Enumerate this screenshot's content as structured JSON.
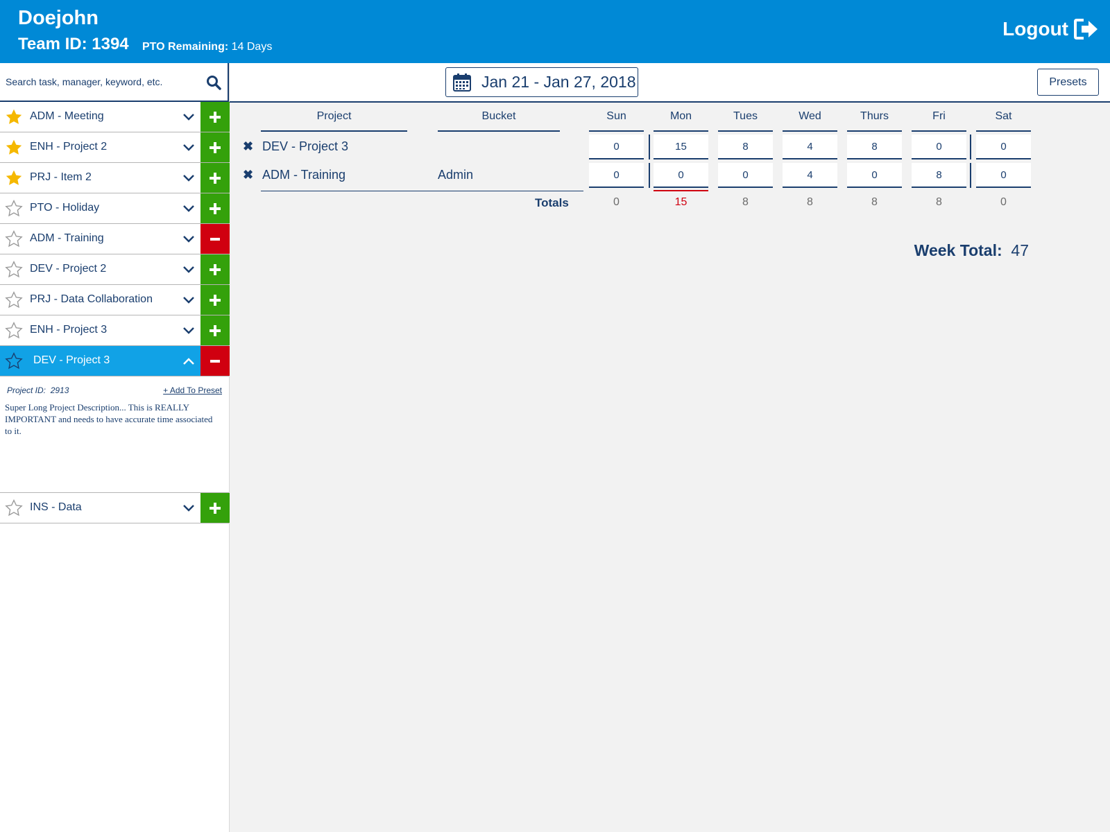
{
  "header": {
    "user_name": "Doejohn",
    "team_id": "Team ID: 1394",
    "pto_label": "PTO Remaining:",
    "pto_value": "14 Days",
    "logout_label": "Logout"
  },
  "search": {
    "placeholder": "Search task, manager, keyword, etc."
  },
  "tasks": [
    {
      "name": "ADM - Meeting",
      "favorite": true,
      "action": "add"
    },
    {
      "name": "ENH - Project 2",
      "favorite": true,
      "action": "add"
    },
    {
      "name": "PRJ - Item 2",
      "favorite": true,
      "action": "add"
    },
    {
      "name": "PTO - Holiday",
      "favorite": false,
      "action": "add"
    },
    {
      "name": "ADM - Training",
      "favorite": false,
      "action": "remove"
    },
    {
      "name": "DEV - Project 2",
      "favorite": false,
      "action": "add"
    },
    {
      "name": "PRJ - Data Collaboration",
      "favorite": false,
      "action": "add"
    },
    {
      "name": "ENH - Project 3",
      "favorite": false,
      "action": "add"
    },
    {
      "name": "DEV - Project 3",
      "favorite": false,
      "action": "remove",
      "expanded": true
    },
    {
      "name": "INS - Data",
      "favorite": false,
      "action": "add"
    }
  ],
  "expanded_detail": {
    "project_id_label": "Project ID:",
    "project_id": "2913",
    "add_to_preset": "+ Add To Preset",
    "description": "Super Long Project Description... This is REALLY IMPORTANT and needs to have accurate time associated to it."
  },
  "toolbar": {
    "date_range": "Jan 21 - Jan 27, 2018",
    "presets_label": "Presets"
  },
  "timesheet": {
    "headers": {
      "project": "Project",
      "bucket": "Bucket"
    },
    "days": [
      "Sun",
      "Mon",
      "Tues",
      "Wed",
      "Thurs",
      "Fri",
      "Sat"
    ],
    "rows": [
      {
        "project": "DEV - Project 3",
        "bucket": "",
        "hours": [
          "0",
          "15",
          "8",
          "4",
          "8",
          "0",
          "0"
        ]
      },
      {
        "project": "ADM - Training",
        "bucket": "Admin",
        "hours": [
          "0",
          "0",
          "0",
          "4",
          "0",
          "8",
          "0"
        ]
      }
    ],
    "totals_label": "Totals",
    "totals": [
      "0",
      "15",
      "8",
      "8",
      "8",
      "8",
      "0"
    ],
    "week_total_label": "Week Total:",
    "week_total": "47"
  },
  "colors": {
    "header_bg": "#0089d6",
    "text": "#1a3e6e",
    "add": "#34a10b",
    "remove": "#d00010",
    "active_row": "#11a2e6",
    "star_filled": "#f5b800"
  }
}
